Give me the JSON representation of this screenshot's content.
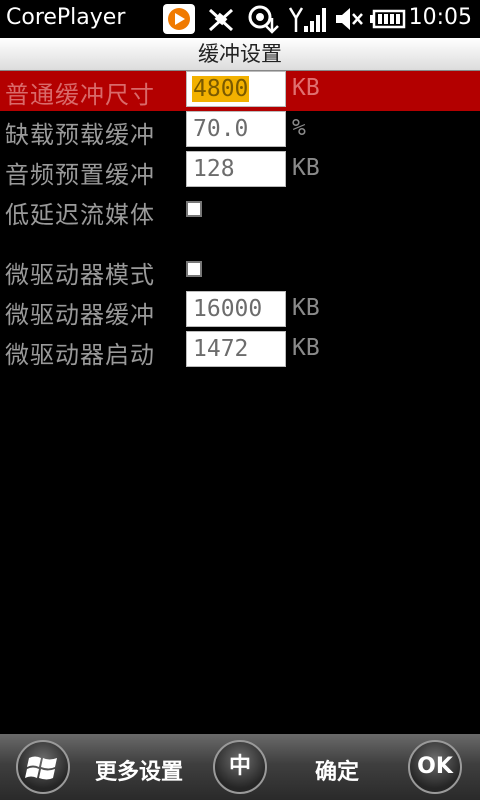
{
  "status_bar": {
    "app_title": "CorePlayer",
    "time": "10:05",
    "icons": [
      "app-logo-icon",
      "satellite-icon",
      "sync-icon",
      "signal-icon",
      "volume-icon",
      "battery-icon"
    ]
  },
  "header": {
    "title": "缓冲设置"
  },
  "settings": {
    "normal_buffer": {
      "label": "普通缓冲尺寸",
      "value": "4800",
      "unit": "KB"
    },
    "underrun_preload": {
      "label": "缺载预载缓冲",
      "value": "70.0",
      "unit": "%"
    },
    "audio_preload": {
      "label": "音频预置缓冲",
      "value": "128",
      "unit": "KB"
    },
    "low_latency": {
      "label": "低延迟流媒体",
      "checked": false
    },
    "micro_driver_mode": {
      "label": "微驱动器模式",
      "checked": false
    },
    "micro_driver_buffer": {
      "label": "微驱动器缓冲",
      "value": "16000",
      "unit": "KB"
    },
    "micro_driver_start": {
      "label": "微驱动器启动",
      "value": "1472",
      "unit": "KB"
    }
  },
  "bottom_bar": {
    "more_settings": "更多设置",
    "input_mode": "中",
    "confirm": "确定",
    "ok": "OK"
  },
  "colors": {
    "selected_row": "#b30000",
    "highlight": "#f2b100",
    "background": "#000000"
  }
}
